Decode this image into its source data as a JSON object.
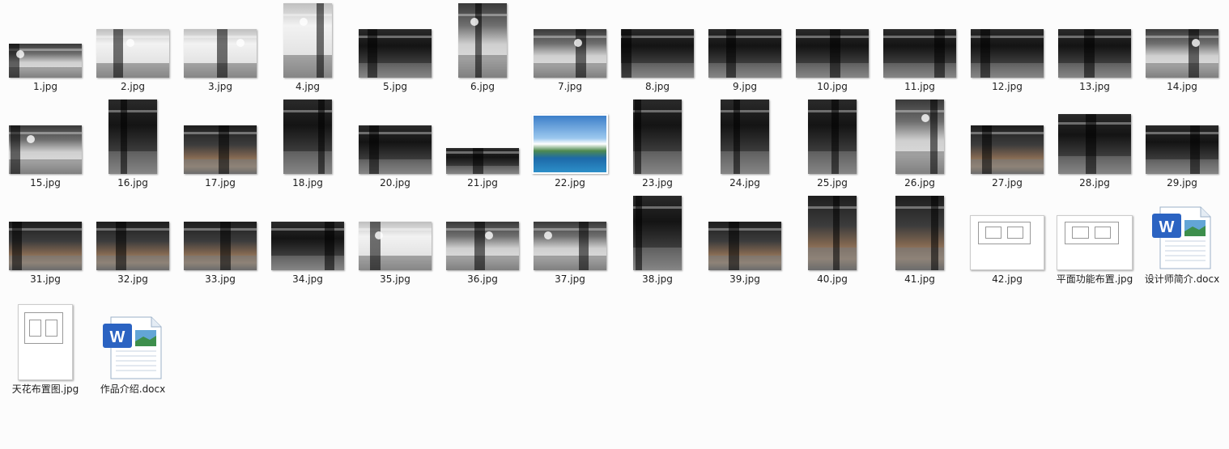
{
  "files": [
    {
      "label": "1.jpg",
      "style": "gray"
    },
    {
      "label": "2.jpg",
      "style": "light"
    },
    {
      "label": "3.jpg",
      "style": "light"
    },
    {
      "label": "4.jpg",
      "style": "light"
    },
    {
      "label": "5.jpg",
      "style": "dark"
    },
    {
      "label": "6.jpg",
      "style": "gray"
    },
    {
      "label": "7.jpg",
      "style": "gray"
    },
    {
      "label": "8.jpg",
      "style": "dark"
    },
    {
      "label": "9.jpg",
      "style": "dark"
    },
    {
      "label": "10.jpg",
      "style": "dark"
    },
    {
      "label": "11.jpg",
      "style": "dark"
    },
    {
      "label": "12.jpg",
      "style": "dark"
    },
    {
      "label": "13.jpg",
      "style": "dark"
    },
    {
      "label": "14.jpg",
      "style": "gray"
    },
    {
      "label": "15.jpg",
      "style": "gray"
    },
    {
      "label": "16.jpg",
      "style": "dark"
    },
    {
      "label": "17.jpg",
      "style": "warm"
    },
    {
      "label": "18.jpg",
      "style": "dark"
    },
    {
      "label": "20.jpg",
      "style": "dark"
    },
    {
      "label": "21.jpg",
      "style": "dark"
    },
    {
      "label": "22.jpg",
      "style": "sea"
    },
    {
      "label": "23.jpg",
      "style": "dark"
    },
    {
      "label": "24.jpg",
      "style": "dark"
    },
    {
      "label": "25.jpg",
      "style": "dark"
    },
    {
      "label": "26.jpg",
      "style": "gray"
    },
    {
      "label": "27.jpg",
      "style": "warm"
    },
    {
      "label": "28.jpg",
      "style": "dark"
    },
    {
      "label": "29.jpg",
      "style": "dark"
    },
    {
      "label": "31.jpg",
      "style": "warm"
    },
    {
      "label": "32.jpg",
      "style": "warm"
    },
    {
      "label": "33.jpg",
      "style": "warm"
    },
    {
      "label": "34.jpg",
      "style": "dark"
    },
    {
      "label": "35.jpg",
      "style": "light"
    },
    {
      "label": "36.jpg",
      "style": "gray"
    },
    {
      "label": "37.jpg",
      "style": "gray"
    },
    {
      "label": "38.jpg",
      "style": "dark"
    },
    {
      "label": "39.jpg",
      "style": "warm"
    },
    {
      "label": "40.jpg",
      "style": "warm"
    },
    {
      "label": "41.jpg",
      "style": "warm"
    },
    {
      "label": "42.jpg",
      "style": "plan"
    },
    {
      "label": "平面功能布置.jpg",
      "style": "plan"
    },
    {
      "label": "设计师简介.docx",
      "style": "docx"
    },
    {
      "label": "天花布置图.jpg",
      "style": "plan"
    },
    {
      "label": "作品介绍.docx",
      "style": "docx"
    }
  ]
}
